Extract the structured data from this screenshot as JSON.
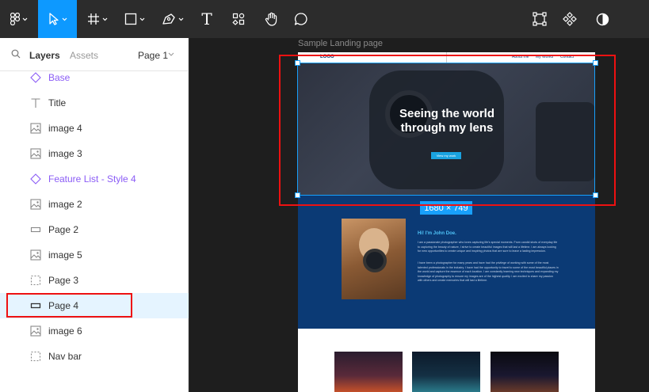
{
  "toolbar": {
    "tools": [
      {
        "name": "main-menu",
        "icon": "figma-logo-icon"
      },
      {
        "name": "move",
        "icon": "cursor-arrow-icon",
        "active": true
      },
      {
        "name": "frame",
        "icon": "hash-frame-icon"
      },
      {
        "name": "shape",
        "icon": "square-icon"
      },
      {
        "name": "pen",
        "icon": "pen-icon"
      },
      {
        "name": "text",
        "icon": "text-icon",
        "label": "T"
      },
      {
        "name": "resources",
        "icon": "resources-icon"
      },
      {
        "name": "hand",
        "icon": "hand-icon"
      },
      {
        "name": "comment",
        "icon": "comment-icon"
      }
    ],
    "right_tools": [
      {
        "name": "edit-object",
        "icon": "frame-edit-icon"
      },
      {
        "name": "components",
        "icon": "component-icon"
      },
      {
        "name": "theme",
        "icon": "contrast-icon"
      }
    ],
    "accent": "#0d99ff"
  },
  "sidebar": {
    "tabs": {
      "layers": "Layers",
      "assets": "Assets",
      "page": "Page 1"
    },
    "layers": [
      {
        "label": "Base",
        "icon": "component-diamond-icon",
        "purple": true
      },
      {
        "label": "Title",
        "icon": "text-icon"
      },
      {
        "label": "image 4",
        "icon": "image-icon"
      },
      {
        "label": "image 3",
        "icon": "image-icon"
      },
      {
        "label": "Feature List - Style 4",
        "icon": "component-diamond-icon",
        "purple": true
      },
      {
        "label": "image 2",
        "icon": "image-icon"
      },
      {
        "label": "Page 2",
        "icon": "rectangle-icon"
      },
      {
        "label": "image 5",
        "icon": "image-icon"
      },
      {
        "label": "Page 3",
        "icon": "dashed-frame-icon"
      },
      {
        "label": "Page 4",
        "icon": "rectangle-icon",
        "selected": true
      },
      {
        "label": "image 6",
        "icon": "image-icon"
      },
      {
        "label": "Nav bar",
        "icon": "dashed-frame-icon"
      }
    ]
  },
  "canvas": {
    "frame_title": "Sample Landing page",
    "nav": {
      "logo": "LOGO",
      "links": [
        "About me",
        "My Works",
        "Contact"
      ]
    },
    "hero": {
      "headline_1": "Seeing the world",
      "headline_2": "through my lens",
      "cta": "View my work"
    },
    "about": {
      "greeting": "Hi! I'm John Doe.",
      "para1": "I am a passionate photographer who loves capturing life's special moments. From candid shots of everyday life to capturing the beauty of nature, I strive to create beautiful images that will last a lifetime. I am always looking for new opportunities to create unique and inspiring photos that are sure to leave a lasting impression.",
      "para2": "I have been a photographer for many years and have had the privilege of working with some of the most talented professionals in the industry. I have had the opportunity to travel to some of the most beautiful places in the world and capture the essence of each location. I am constantly learning new techniques and expanding my knowledge of photography to ensure my images are of the highest quality. I am excited to share my passion with others and create memories that will last a lifetime."
    },
    "selection_size": "1680 × 749"
  }
}
